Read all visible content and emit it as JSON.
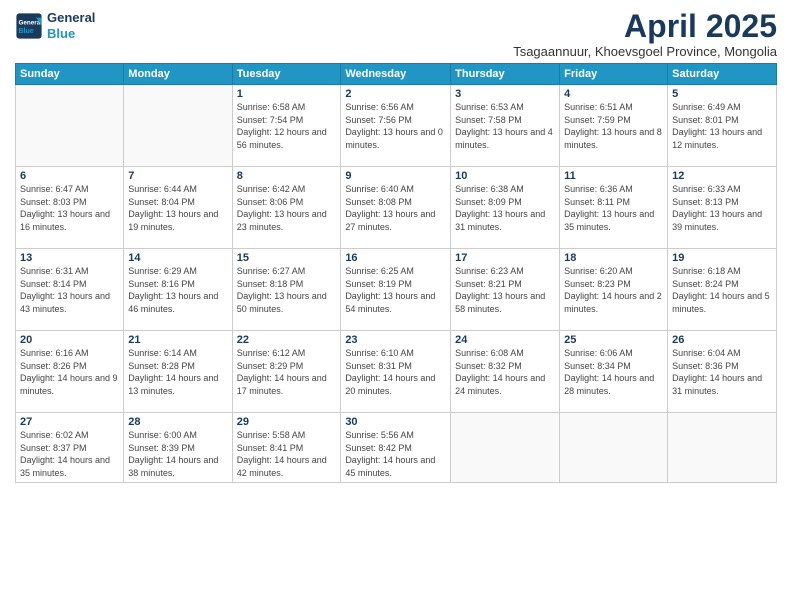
{
  "logo": {
    "line1": "General",
    "line2": "Blue"
  },
  "title": "April 2025",
  "subtitle": "Tsagaannuur, Khoevsgoel Province, Mongolia",
  "weekdays": [
    "Sunday",
    "Monday",
    "Tuesday",
    "Wednesday",
    "Thursday",
    "Friday",
    "Saturday"
  ],
  "weeks": [
    [
      {
        "day": "",
        "info": ""
      },
      {
        "day": "",
        "info": ""
      },
      {
        "day": "1",
        "info": "Sunrise: 6:58 AM\nSunset: 7:54 PM\nDaylight: 12 hours and 56 minutes."
      },
      {
        "day": "2",
        "info": "Sunrise: 6:56 AM\nSunset: 7:56 PM\nDaylight: 13 hours and 0 minutes."
      },
      {
        "day": "3",
        "info": "Sunrise: 6:53 AM\nSunset: 7:58 PM\nDaylight: 13 hours and 4 minutes."
      },
      {
        "day": "4",
        "info": "Sunrise: 6:51 AM\nSunset: 7:59 PM\nDaylight: 13 hours and 8 minutes."
      },
      {
        "day": "5",
        "info": "Sunrise: 6:49 AM\nSunset: 8:01 PM\nDaylight: 13 hours and 12 minutes."
      }
    ],
    [
      {
        "day": "6",
        "info": "Sunrise: 6:47 AM\nSunset: 8:03 PM\nDaylight: 13 hours and 16 minutes."
      },
      {
        "day": "7",
        "info": "Sunrise: 6:44 AM\nSunset: 8:04 PM\nDaylight: 13 hours and 19 minutes."
      },
      {
        "day": "8",
        "info": "Sunrise: 6:42 AM\nSunset: 8:06 PM\nDaylight: 13 hours and 23 minutes."
      },
      {
        "day": "9",
        "info": "Sunrise: 6:40 AM\nSunset: 8:08 PM\nDaylight: 13 hours and 27 minutes."
      },
      {
        "day": "10",
        "info": "Sunrise: 6:38 AM\nSunset: 8:09 PM\nDaylight: 13 hours and 31 minutes."
      },
      {
        "day": "11",
        "info": "Sunrise: 6:36 AM\nSunset: 8:11 PM\nDaylight: 13 hours and 35 minutes."
      },
      {
        "day": "12",
        "info": "Sunrise: 6:33 AM\nSunset: 8:13 PM\nDaylight: 13 hours and 39 minutes."
      }
    ],
    [
      {
        "day": "13",
        "info": "Sunrise: 6:31 AM\nSunset: 8:14 PM\nDaylight: 13 hours and 43 minutes."
      },
      {
        "day": "14",
        "info": "Sunrise: 6:29 AM\nSunset: 8:16 PM\nDaylight: 13 hours and 46 minutes."
      },
      {
        "day": "15",
        "info": "Sunrise: 6:27 AM\nSunset: 8:18 PM\nDaylight: 13 hours and 50 minutes."
      },
      {
        "day": "16",
        "info": "Sunrise: 6:25 AM\nSunset: 8:19 PM\nDaylight: 13 hours and 54 minutes."
      },
      {
        "day": "17",
        "info": "Sunrise: 6:23 AM\nSunset: 8:21 PM\nDaylight: 13 hours and 58 minutes."
      },
      {
        "day": "18",
        "info": "Sunrise: 6:20 AM\nSunset: 8:23 PM\nDaylight: 14 hours and 2 minutes."
      },
      {
        "day": "19",
        "info": "Sunrise: 6:18 AM\nSunset: 8:24 PM\nDaylight: 14 hours and 5 minutes."
      }
    ],
    [
      {
        "day": "20",
        "info": "Sunrise: 6:16 AM\nSunset: 8:26 PM\nDaylight: 14 hours and 9 minutes."
      },
      {
        "day": "21",
        "info": "Sunrise: 6:14 AM\nSunset: 8:28 PM\nDaylight: 14 hours and 13 minutes."
      },
      {
        "day": "22",
        "info": "Sunrise: 6:12 AM\nSunset: 8:29 PM\nDaylight: 14 hours and 17 minutes."
      },
      {
        "day": "23",
        "info": "Sunrise: 6:10 AM\nSunset: 8:31 PM\nDaylight: 14 hours and 20 minutes."
      },
      {
        "day": "24",
        "info": "Sunrise: 6:08 AM\nSunset: 8:32 PM\nDaylight: 14 hours and 24 minutes."
      },
      {
        "day": "25",
        "info": "Sunrise: 6:06 AM\nSunset: 8:34 PM\nDaylight: 14 hours and 28 minutes."
      },
      {
        "day": "26",
        "info": "Sunrise: 6:04 AM\nSunset: 8:36 PM\nDaylight: 14 hours and 31 minutes."
      }
    ],
    [
      {
        "day": "27",
        "info": "Sunrise: 6:02 AM\nSunset: 8:37 PM\nDaylight: 14 hours and 35 minutes."
      },
      {
        "day": "28",
        "info": "Sunrise: 6:00 AM\nSunset: 8:39 PM\nDaylight: 14 hours and 38 minutes."
      },
      {
        "day": "29",
        "info": "Sunrise: 5:58 AM\nSunset: 8:41 PM\nDaylight: 14 hours and 42 minutes."
      },
      {
        "day": "30",
        "info": "Sunrise: 5:56 AM\nSunset: 8:42 PM\nDaylight: 14 hours and 45 minutes."
      },
      {
        "day": "",
        "info": ""
      },
      {
        "day": "",
        "info": ""
      },
      {
        "day": "",
        "info": ""
      }
    ]
  ]
}
